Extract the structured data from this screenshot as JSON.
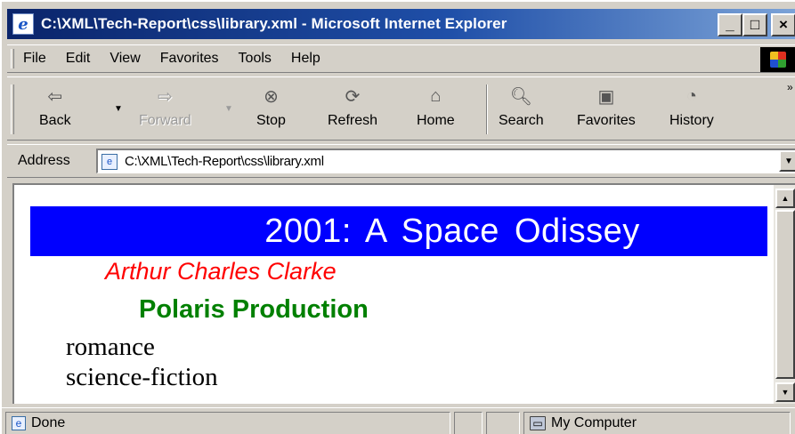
{
  "window": {
    "title": "C:\\XML\\Tech-Report\\css\\library.xml - Microsoft Internet Explorer",
    "controls": {
      "minimize": "_",
      "maximize": "□",
      "close": "×"
    }
  },
  "menu": [
    "File",
    "Edit",
    "View",
    "Favorites",
    "Tools",
    "Help"
  ],
  "toolbar": {
    "back": "Back",
    "forward": "Forward",
    "stop": "Stop",
    "refresh": "Refresh",
    "home": "Home",
    "search": "Search",
    "favorites": "Favorites",
    "history": "History",
    "icons": {
      "back": "back-arrow-icon",
      "forward": "forward-arrow-icon",
      "stop": "stop-icon",
      "refresh": "refresh-icon",
      "home": "home-icon",
      "search": "search-icon",
      "favorites": "favorites-folder-icon",
      "history": "history-icon"
    }
  },
  "address": {
    "label": "Address",
    "value": "C:\\XML\\Tech-Report\\css\\library.xml"
  },
  "document": {
    "title": "2001: A Space Odissey",
    "author": "Arthur Charles Clarke",
    "publisher": "Polaris Production",
    "genres": [
      "romance",
      "science-fiction"
    ],
    "colors": {
      "title_bg": "#0000ff",
      "title_text": "#ffffff",
      "author": "#ff0000",
      "publisher": "#008000",
      "genre": "#000000"
    }
  },
  "status": {
    "text": "Done",
    "zone": "My Computer"
  }
}
